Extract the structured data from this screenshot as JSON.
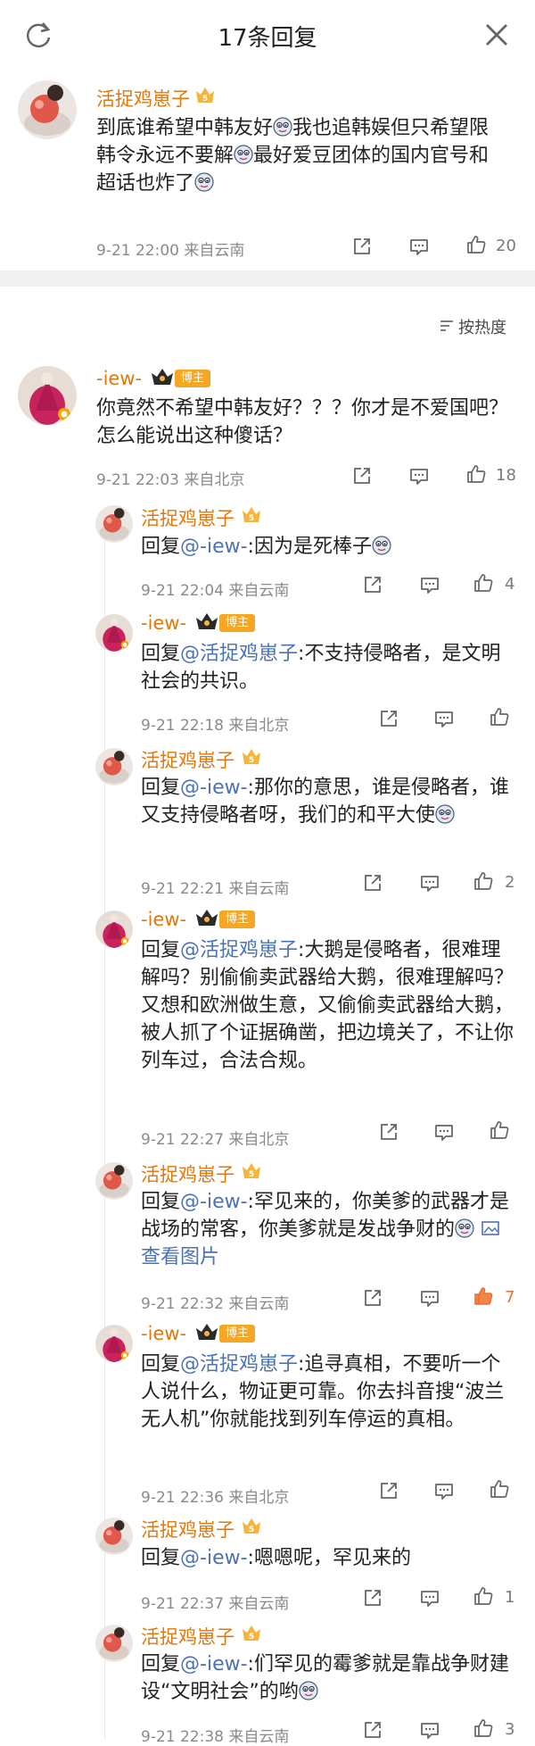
{
  "header": {
    "title": "17条回复"
  },
  "top_comment": {
    "user": "活捉鸡崽子",
    "text_parts": [
      "到底谁希望中韩友好",
      "我也追韩娱但只希望限韩令永远不要解",
      "最好爱豆团体的国内官号和超话也炸了"
    ],
    "time": "9-21 22:00",
    "source": "来自云南",
    "likes": "20"
  },
  "sort_label": "按热度",
  "root_comment": {
    "user": "-iew-",
    "badge": "博主",
    "text": "你竟然不希望中韩友好？？？你才是不爱国吧？怎么能说出这种傻话？",
    "time": "9-21 22:03",
    "source": "来自北京",
    "likes": "18"
  },
  "replies": [
    {
      "user": "活捉鸡崽子",
      "prefix": "回复",
      "target": "@-iew-",
      "text": ":因为是死棒子",
      "time": "9-21 22:04",
      "source": "来自云南",
      "likes": "4"
    },
    {
      "user": "-iew-",
      "badge": "博主",
      "prefix": "回复",
      "target": "@活捉鸡崽子",
      "text": ":不支持侵略者，是文明社会的共识。",
      "time": "9-21 22:18",
      "source": "来自北京",
      "likes": ""
    },
    {
      "user": "活捉鸡崽子",
      "prefix": "回复",
      "target": "@-iew-",
      "text": ":那你的意思，谁是侵略者，谁又支持侵略者呀，我们的和平大使",
      "time": "9-21 22:21",
      "source": "来自云南",
      "likes": "2"
    },
    {
      "user": "-iew-",
      "badge": "博主",
      "prefix": "回复",
      "target": "@活捉鸡崽子",
      "text": ":大鹅是侵略者，很难理解吗？别偷偷卖武器给大鹅，很难理解吗？又想和欧洲做生意，又偷偷卖武器给大鹅，被人抓了个证据确凿，把边境关了，不让你列车过，合法合规。",
      "time": "9-21 22:27",
      "source": "来自北京",
      "likes": ""
    },
    {
      "user": "活捉鸡崽子",
      "prefix": "回复",
      "target": "@-iew-",
      "text": ":罕见来的，你美爹的武器才是战场的常客，你美爹就是发战争财的",
      "image_link": "查看图片",
      "time": "9-21 22:32",
      "source": "来自云南",
      "likes": "7"
    },
    {
      "user": "-iew-",
      "badge": "博主",
      "prefix": "回复",
      "target": "@活捉鸡崽子",
      "text": ":追寻真相，不要听一个人说什么，物证更可靠。你去抖音搜“波兰 无人机”你就能找到列车停运的真相。",
      "time": "9-21 22:36",
      "source": "来自北京",
      "likes": ""
    },
    {
      "user": "活捉鸡崽子",
      "prefix": "回复",
      "target": "@-iew-",
      "text": ":嗯嗯呢，罕见来的",
      "time": "9-21 22:37",
      "source": "来自云南",
      "likes": "1"
    },
    {
      "user": "活捉鸡崽子",
      "prefix": "回复",
      "target": "@-iew-",
      "text": ":们罕见的霉爹就是靠战争财建设“文明社会”的哟",
      "time": "9-21 22:38",
      "source": "来自云南",
      "likes": "3"
    }
  ],
  "colors": {
    "username": "#e0780d",
    "link": "#4a72b6",
    "liked": "#e96f32",
    "meta": "#8a8a8a"
  }
}
